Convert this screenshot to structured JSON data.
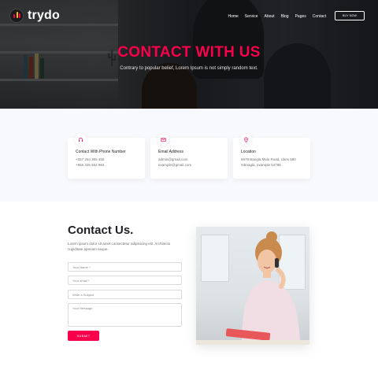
{
  "brand": {
    "name": "trydo"
  },
  "nav": {
    "items": [
      "Home",
      "Service",
      "About",
      "Blog",
      "Pages",
      "Contact"
    ],
    "cta": "BUY NOW"
  },
  "hero": {
    "title": "CONTACT WITH US",
    "subtitle": "Contrary to popular belief, Lorem Ipsum is not simply random text."
  },
  "info_cards": [
    {
      "icon": "headphones-icon",
      "title": "Contact With Phone Number",
      "lines": [
        "+057 254 365 456",
        "+856 325 652 984"
      ]
    },
    {
      "icon": "mail-icon",
      "title": "Email Address",
      "lines": [
        "admin@gmail.com",
        "example@gmail.com"
      ]
    },
    {
      "icon": "location-pin-icon",
      "title": "Location",
      "lines": [
        "5678 Bangla Main Road, cities 580",
        "GBnagla, example 54786"
      ]
    }
  ],
  "contact": {
    "title": "Contact Us.",
    "description": "Lorem ipsum dolor sit amet consectetur adipisicing elit. Architecto cupiditate aperiam neque.",
    "fields": {
      "name": "Your Name *",
      "email": "Your email *",
      "subject": "Write a Subject",
      "message": "Your Message"
    },
    "submit": "SUBMIT"
  },
  "colors": {
    "accent": "#f9004d",
    "heading": "#1f1f25",
    "body_text": "#717173",
    "section_bg": "#f8f9fc"
  }
}
